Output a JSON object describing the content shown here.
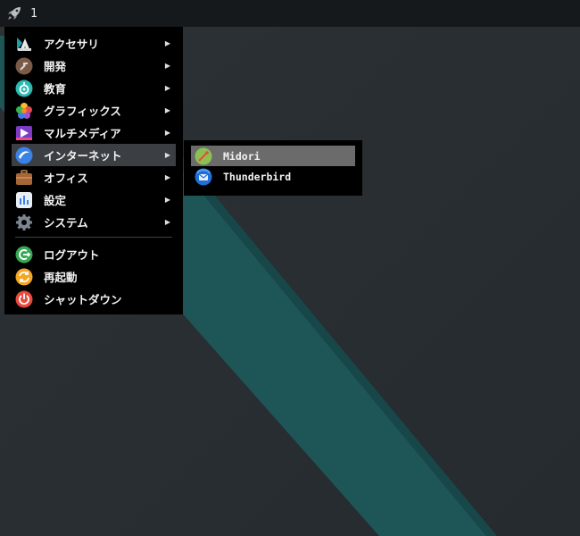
{
  "taskbar": {
    "launcher_icon": "rocket-icon",
    "workspace_label": "1"
  },
  "menu": {
    "items": [
      {
        "label": "アクセサリ",
        "icon": "accessories-icon",
        "has_submenu": true
      },
      {
        "label": "開発",
        "icon": "development-icon",
        "has_submenu": true
      },
      {
        "label": "教育",
        "icon": "education-icon",
        "has_submenu": true
      },
      {
        "label": "グラフィックス",
        "icon": "graphics-icon",
        "has_submenu": true
      },
      {
        "label": "マルチメディア",
        "icon": "multimedia-icon",
        "has_submenu": true
      },
      {
        "label": "インターネット",
        "icon": "internet-icon",
        "has_submenu": true,
        "active": true
      },
      {
        "label": "オフィス",
        "icon": "office-icon",
        "has_submenu": true
      },
      {
        "label": "設定",
        "icon": "settings-icon",
        "has_submenu": true
      },
      {
        "label": "システム",
        "icon": "system-icon",
        "has_submenu": true
      }
    ],
    "actions": [
      {
        "label": "ログアウト",
        "icon": "logout-icon"
      },
      {
        "label": "再起動",
        "icon": "restart-icon"
      },
      {
        "label": "シャットダウン",
        "icon": "shutdown-icon"
      }
    ],
    "submenu_arrow": "▶"
  },
  "submenu": {
    "items": [
      {
        "label": "Midori",
        "icon": "midori-icon",
        "active": true
      },
      {
        "label": "Thunderbird",
        "icon": "thunderbird-icon"
      }
    ]
  },
  "colors": {
    "desktop": "#272d31",
    "stripe": "#1e5658",
    "menu_bg": "#000000",
    "highlight": "#3b3f43",
    "sub_highlight": "#6b6b6b"
  }
}
